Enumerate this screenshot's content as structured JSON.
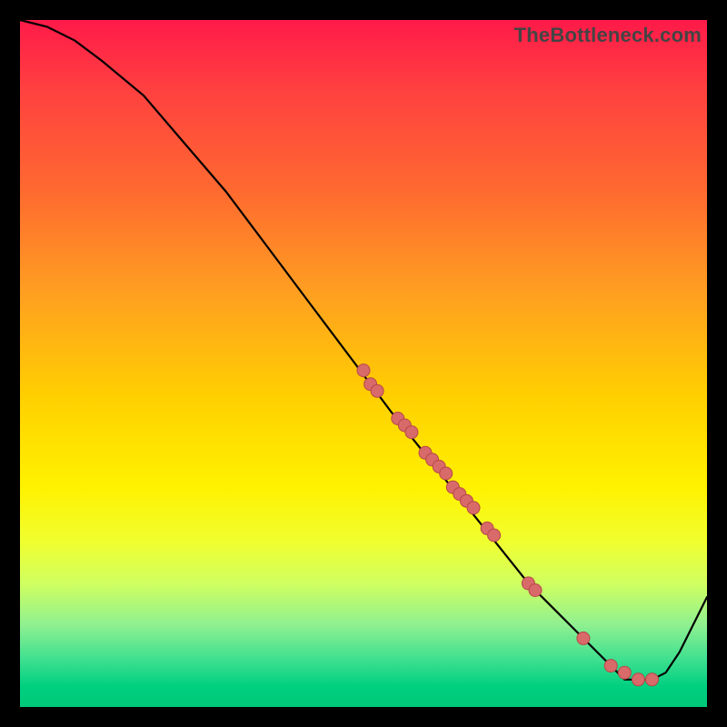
{
  "watermark": "TheBottleneck.com",
  "chart_data": {
    "type": "line",
    "title": "",
    "xlabel": "",
    "ylabel": "",
    "xlim": [
      0,
      100
    ],
    "ylim": [
      0,
      100
    ],
    "background_gradient": {
      "top": "#ff1a49",
      "bottom": "#00c878",
      "comment": "vertical gradient red→yellow→green implies lower y is better (green)"
    },
    "series": [
      {
        "name": "bottleneck-curve",
        "comment": "Black curve. x in 0–100, y in 0–100. Starts at top-left, descends to a minimum near x≈88, then rises again.",
        "x": [
          0,
          4,
          8,
          12,
          18,
          24,
          30,
          36,
          42,
          48,
          54,
          58,
          62,
          66,
          70,
          74,
          78,
          82,
          86,
          88,
          90,
          92,
          94,
          96,
          98,
          100
        ],
        "y": [
          100,
          99,
          97,
          94,
          89,
          82,
          75,
          67,
          59,
          51,
          43,
          38,
          33,
          28,
          23,
          18,
          14,
          10,
          6,
          4,
          4,
          4,
          5,
          8,
          12,
          16
        ]
      }
    ],
    "points": {
      "name": "highlighted-data-points",
      "color": "#d86a6a",
      "radius_px": 7,
      "comment": "Approximate (x,y) positions of the salmon dots lying on the curve.",
      "data": [
        {
          "x": 50,
          "y": 49
        },
        {
          "x": 51,
          "y": 47
        },
        {
          "x": 52,
          "y": 46
        },
        {
          "x": 55,
          "y": 42
        },
        {
          "x": 56,
          "y": 41
        },
        {
          "x": 57,
          "y": 40
        },
        {
          "x": 59,
          "y": 37
        },
        {
          "x": 60,
          "y": 36
        },
        {
          "x": 61,
          "y": 35
        },
        {
          "x": 62,
          "y": 34
        },
        {
          "x": 63,
          "y": 32
        },
        {
          "x": 64,
          "y": 31
        },
        {
          "x": 65,
          "y": 30
        },
        {
          "x": 66,
          "y": 29
        },
        {
          "x": 68,
          "y": 26
        },
        {
          "x": 69,
          "y": 25
        },
        {
          "x": 74,
          "y": 18
        },
        {
          "x": 75,
          "y": 17
        },
        {
          "x": 82,
          "y": 10
        },
        {
          "x": 86,
          "y": 6
        },
        {
          "x": 88,
          "y": 5
        },
        {
          "x": 90,
          "y": 4
        },
        {
          "x": 92,
          "y": 4
        }
      ]
    }
  }
}
